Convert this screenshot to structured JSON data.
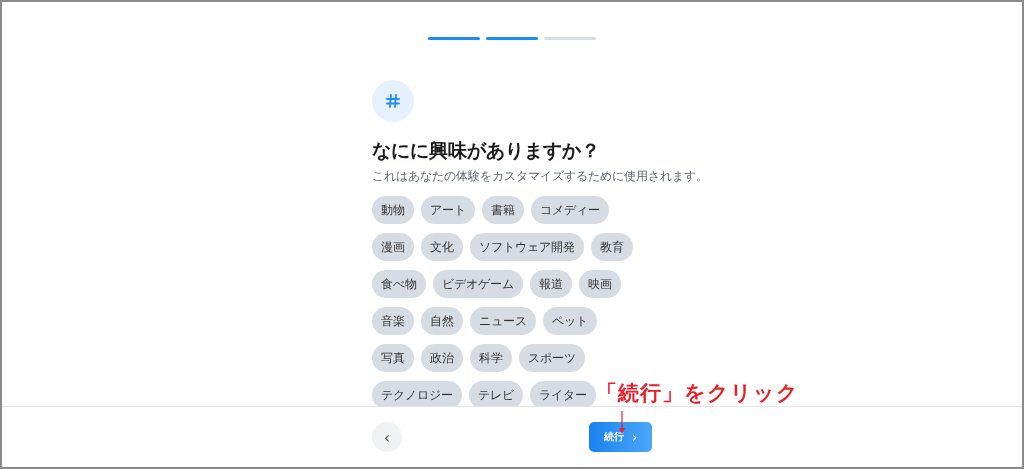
{
  "progress": [
    {
      "done": true
    },
    {
      "done": true
    },
    {
      "done": false
    }
  ],
  "title": "なにに興味がありますか？",
  "subtitle": "これはあなたの体験をカスタマイズするために使用されます。",
  "topics": [
    [
      "動物",
      "アート",
      "書籍",
      "コメディー"
    ],
    [
      "漫画",
      "文化",
      "ソフトウェア開発",
      "教育"
    ],
    [
      "食べ物",
      "ビデオゲーム",
      "報道",
      "映画"
    ],
    [
      "音楽",
      "自然",
      "ニュース",
      "ペット"
    ],
    [
      "写真",
      "政治",
      "科学",
      "スポーツ"
    ],
    [
      "テクノロジー",
      "テレビ",
      "ライター"
    ]
  ],
  "footer": {
    "back": "‹",
    "continue": "続行",
    "continue_icon": "›"
  },
  "annotation": "「続行」をクリック"
}
